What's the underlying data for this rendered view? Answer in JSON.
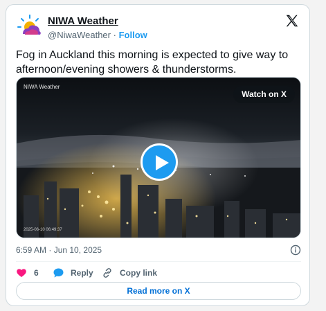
{
  "author": {
    "name": "NIWA Weather",
    "handle": "@NiwaWeather",
    "separator": "·",
    "follow_label": "Follow",
    "avatar_icon": "niwa-cloud-sun-logo"
  },
  "tweet": {
    "text": "Fog in Auckland this morning is expected to give way to afternoon/evening showers & thunderstorms."
  },
  "media": {
    "camera_label": "NIWA Weather",
    "watch_label": "Watch on X",
    "overlay_timestamp": "2025-06-10 06:49:37",
    "play_icon": "play-icon"
  },
  "meta": {
    "posted_at": "6:59 AM · Jun 10, 2025",
    "info_icon": "info-icon"
  },
  "actions": {
    "like_count": "6",
    "reply_label": "Reply",
    "copy_label": "Copy link"
  },
  "read_more_label": "Read more on X",
  "colors": {
    "accent": "#1d9bf0",
    "like": "#f91880",
    "link": "#006fd6",
    "text_secondary": "#536471"
  }
}
